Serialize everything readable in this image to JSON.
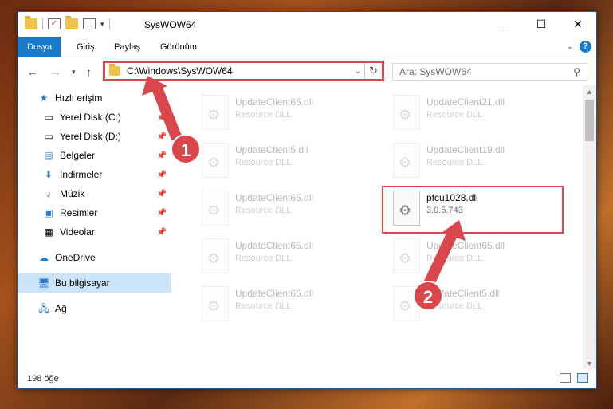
{
  "window": {
    "title": "SysWOW64",
    "controls": {
      "minimize": "—",
      "maximize": "☐",
      "close": "✕"
    }
  },
  "ribbon": {
    "tabs": [
      "Dosya",
      "Giriş",
      "Paylaş",
      "Görünüm"
    ],
    "active_tab": "Dosya",
    "help": "?"
  },
  "nav": {
    "address": "C:\\Windows\\SysWOW64",
    "search_placeholder": "Ara: SysWOW64"
  },
  "sidebar": {
    "items": [
      {
        "label": "Hızlı erişim",
        "icon": "star-icon",
        "pinned": false
      },
      {
        "label": "Yerel Disk (C:)",
        "icon": "drive-icon",
        "pinned": true
      },
      {
        "label": "Yerel Disk (D:)",
        "icon": "drive-icon",
        "pinned": true
      },
      {
        "label": "Belgeler",
        "icon": "documents-icon",
        "pinned": true
      },
      {
        "label": "İndirmeler",
        "icon": "download-icon",
        "pinned": true
      },
      {
        "label": "Müzik",
        "icon": "music-icon",
        "pinned": true
      },
      {
        "label": "Resimler",
        "icon": "pictures-icon",
        "pinned": true
      },
      {
        "label": "Videolar",
        "icon": "videos-icon",
        "pinned": true
      },
      {
        "label": "OneDrive",
        "icon": "cloud-icon",
        "pinned": false
      },
      {
        "label": "Bu bilgisayar",
        "icon": "computer-icon",
        "pinned": false,
        "selected": true
      },
      {
        "label": "Ağ",
        "icon": "network-icon",
        "pinned": false
      }
    ]
  },
  "files": [
    {
      "name": "UpdateClient65.dll",
      "type": "Resource DLL",
      "faded": true
    },
    {
      "name": "UpdateClient21.dll",
      "type": "Resource DLL",
      "faded": true
    },
    {
      "name": "UpdateClient5.dll",
      "type": "Resource DLL",
      "faded": true
    },
    {
      "name": "UpdateClient19.dll",
      "type": "Resource DLL",
      "faded": true
    },
    {
      "name": "UpdateClient65.dll",
      "type": "Resource DLL",
      "faded": true
    },
    {
      "name": "pfcu1028.dll",
      "type": "3.0.5.743",
      "faded": false,
      "highlight": true
    },
    {
      "name": "UpdateClient65.dll",
      "type": "Resource DLL",
      "faded": true
    },
    {
      "name": "UpdateClient65.dll",
      "type": "Resource DLL",
      "faded": true
    },
    {
      "name": "UpdateClient65.dll",
      "type": "Resource DLL",
      "faded": true
    },
    {
      "name": "UpdateClient5.dll",
      "type": "Resource DLL",
      "faded": true
    }
  ],
  "status": {
    "count": "198 öğe"
  },
  "annotations": {
    "step1": "1",
    "step2": "2",
    "color": "#d9474c"
  }
}
